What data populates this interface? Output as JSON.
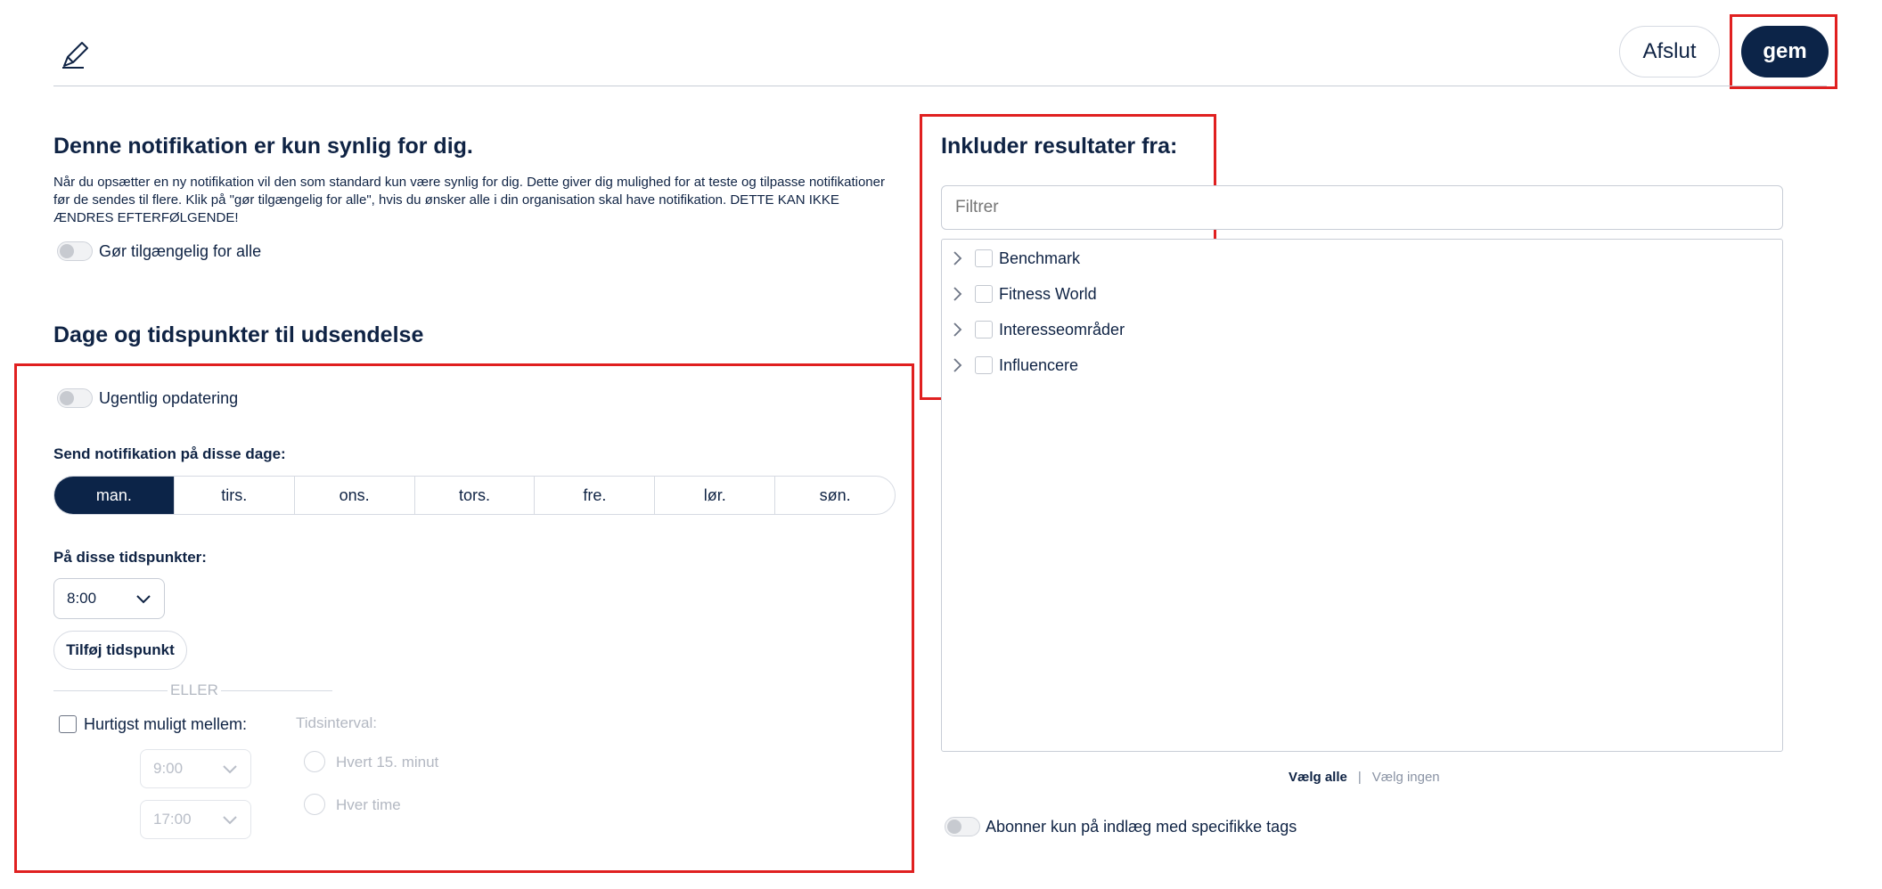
{
  "header": {
    "exit_label": "Afslut",
    "save_label": "gem"
  },
  "visibility": {
    "title": "Denne notifikation er kun synlig for dig.",
    "description": "Når du opsætter en ny notifikation vil den som standard kun være synlig for dig. Dette giver dig mulighed for at teste og tilpasse notifikationer før de sendes til flere. Klik på \"gør tilgængelig for alle\", hvis du ønsker alle i din organisation skal have notifikation. DETTE KAN IKKE ÆNDRES EFTERFØLGENDE!",
    "toggle_label": "Gør tilgængelig for alle"
  },
  "schedule": {
    "title": "Dage og tidspunkter til udsendelse",
    "weekly_label": "Ugentlig opdatering",
    "days_label": "Send notifikation på disse dage:",
    "days": [
      "man.",
      "tirs.",
      "ons.",
      "tors.",
      "fre.",
      "lør.",
      "søn."
    ],
    "active_day": "man.",
    "times_label": "På disse tidspunkter:",
    "time_value": "8:00",
    "add_time_label": "Tilføj tidspunkt",
    "or_label": "ELLER",
    "asap_label": "Hurtigst muligt mellem:",
    "from_value": "9:00",
    "to_value": "17:00",
    "interval_label": "Tidsinterval:",
    "interval_options": [
      "Hvert 15. minut",
      "Hver time"
    ]
  },
  "sources": {
    "title": "Inkluder resultater fra:",
    "filter_placeholder": "Filtrer",
    "items": [
      "Benchmark",
      "Fitness World",
      "Interesseområder",
      "Influencere"
    ],
    "select_all": "Vælg alle",
    "separator": "|",
    "select_none": "Vælg ingen",
    "tags_toggle_label": "Abonner kun på indlæg med specifikke tags"
  },
  "colors": {
    "primary": "#0c2448",
    "highlight": "#e02020",
    "muted": "#b3b8c2"
  }
}
